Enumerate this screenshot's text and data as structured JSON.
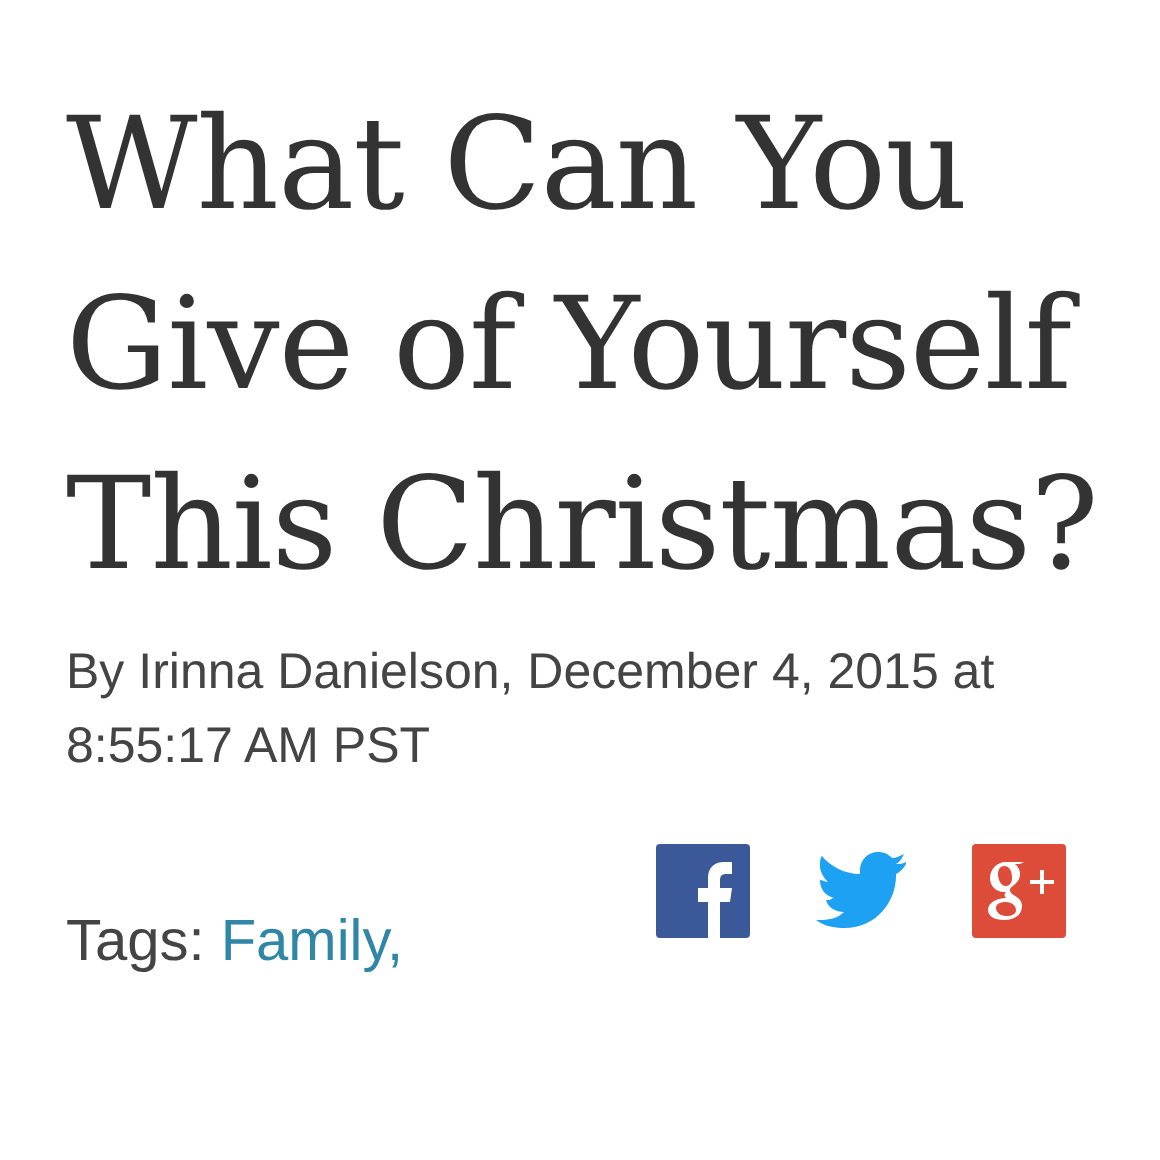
{
  "article": {
    "title": "What Can You Give of Yourself This Christmas?",
    "byline": "By Irinna Danielson, December 4, 2015 at 8:55:17 AM PST"
  },
  "tags": {
    "label": "Tags:",
    "items": [
      "Family,"
    ]
  },
  "share": [
    {
      "kind": "facebook"
    },
    {
      "kind": "twitter"
    },
    {
      "kind": "googleplus"
    }
  ]
}
